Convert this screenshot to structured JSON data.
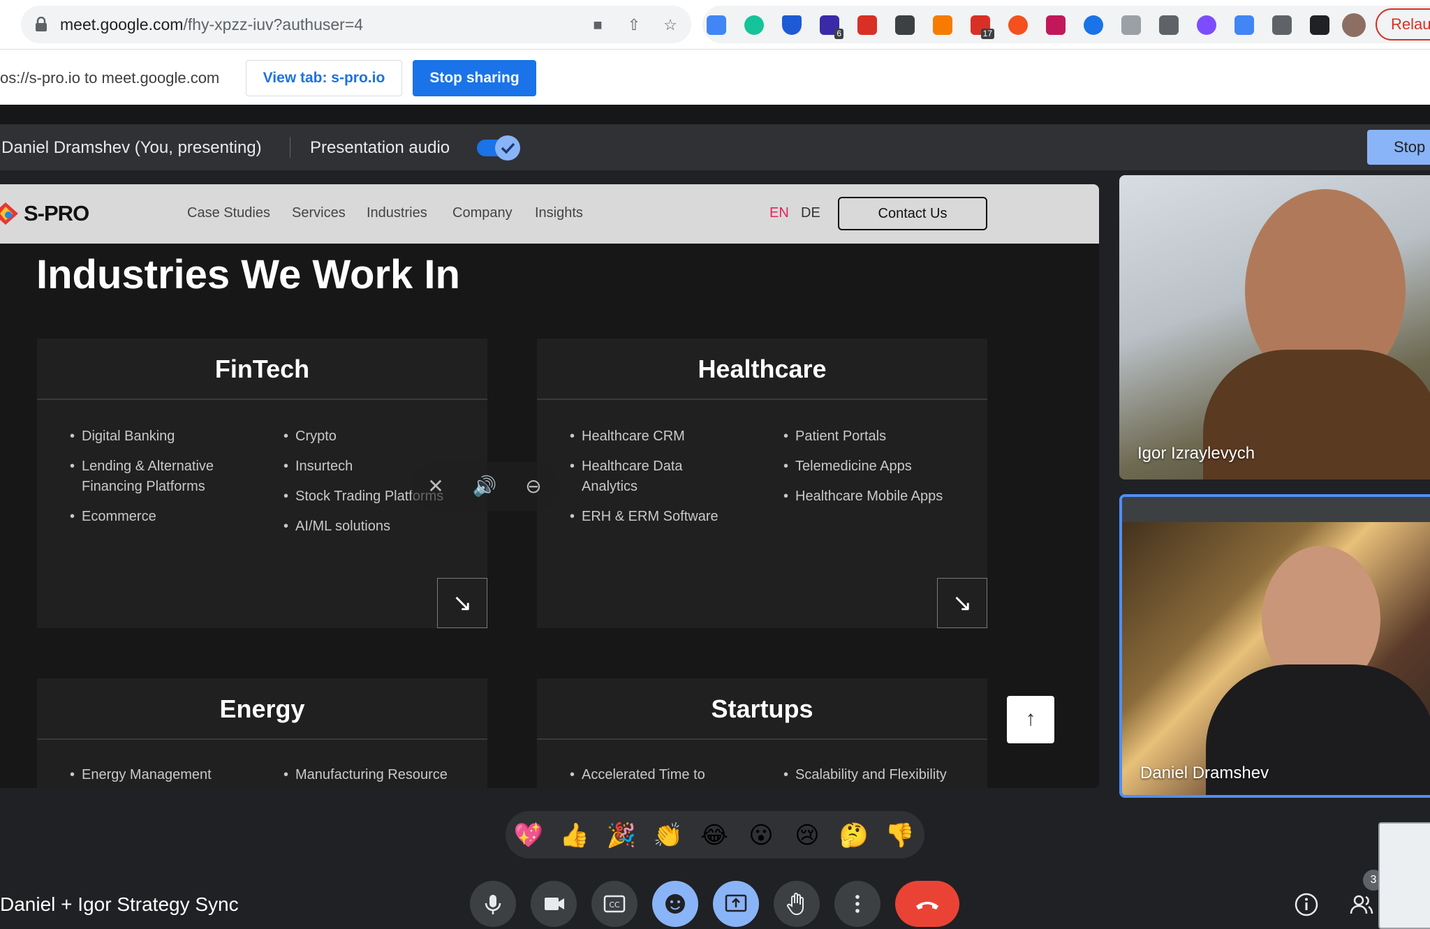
{
  "browser": {
    "url_domain": "meet.google.com",
    "url_path": "/fhy-xpzz-iuv?authuser=4",
    "relaunch_label": "Relau",
    "extension_badges": [
      "6",
      "17"
    ]
  },
  "sharebar": {
    "message": "os://s-pro.io to meet.google.com",
    "view_tab_label": "View tab: s-pro.io",
    "stop_sharing_label": "Stop sharing"
  },
  "presenting": {
    "presenter": "Daniel Dramshev (You, presenting)",
    "audio_label": "Presentation audio",
    "audio_on": true,
    "stop_label": "Stop"
  },
  "site": {
    "logo": "S-PRO",
    "nav": [
      "Case Studies",
      "Services",
      "Industries",
      "Company",
      "Insights"
    ],
    "lang_active": "EN",
    "lang_other": "DE",
    "contact_label": "Contact Us",
    "heading": "Industries We Work In",
    "cards": [
      {
        "title": "FinTech",
        "col1": [
          "Digital Banking",
          "Lending & Alternative",
          "Financing Platforms",
          "Ecommerce"
        ],
        "col2": [
          "Crypto",
          "Insurtech",
          "Stock Trading Platforms",
          "AI/ML solutions"
        ]
      },
      {
        "title": "Healthcare",
        "col1": [
          "Healthcare CRM",
          "Healthcare Data",
          "Analytics",
          "ERH & ERM Software"
        ],
        "col2": [
          "Patient Portals",
          "Telemedicine Apps",
          "Healthcare Mobile Apps"
        ]
      },
      {
        "title": "Energy",
        "col1": [
          "Energy Management"
        ],
        "col2": [
          "Manufacturing Resource"
        ]
      },
      {
        "title": "Startups",
        "col1": [
          "Accelerated Time to"
        ],
        "col2": [
          "Scalability and Flexibility"
        ]
      }
    ],
    "arrow_glyph": "↘",
    "up_glyph": "↑"
  },
  "participants": [
    {
      "name": "Igor Izraylevych"
    },
    {
      "name": "Daniel Dramshev"
    }
  ],
  "reactions": [
    "💖",
    "👍",
    "🎉",
    "👏",
    "😂",
    "😮",
    "😢",
    "🤔",
    "👎"
  ],
  "meeting": {
    "title": "Daniel + Igor Strategy Sync",
    "participant_count": "3"
  },
  "colors": {
    "accent": "#1a73e8",
    "meet_blue": "#8ab4f8",
    "end_call": "#ea4335",
    "lang_active": "#e0245e"
  }
}
